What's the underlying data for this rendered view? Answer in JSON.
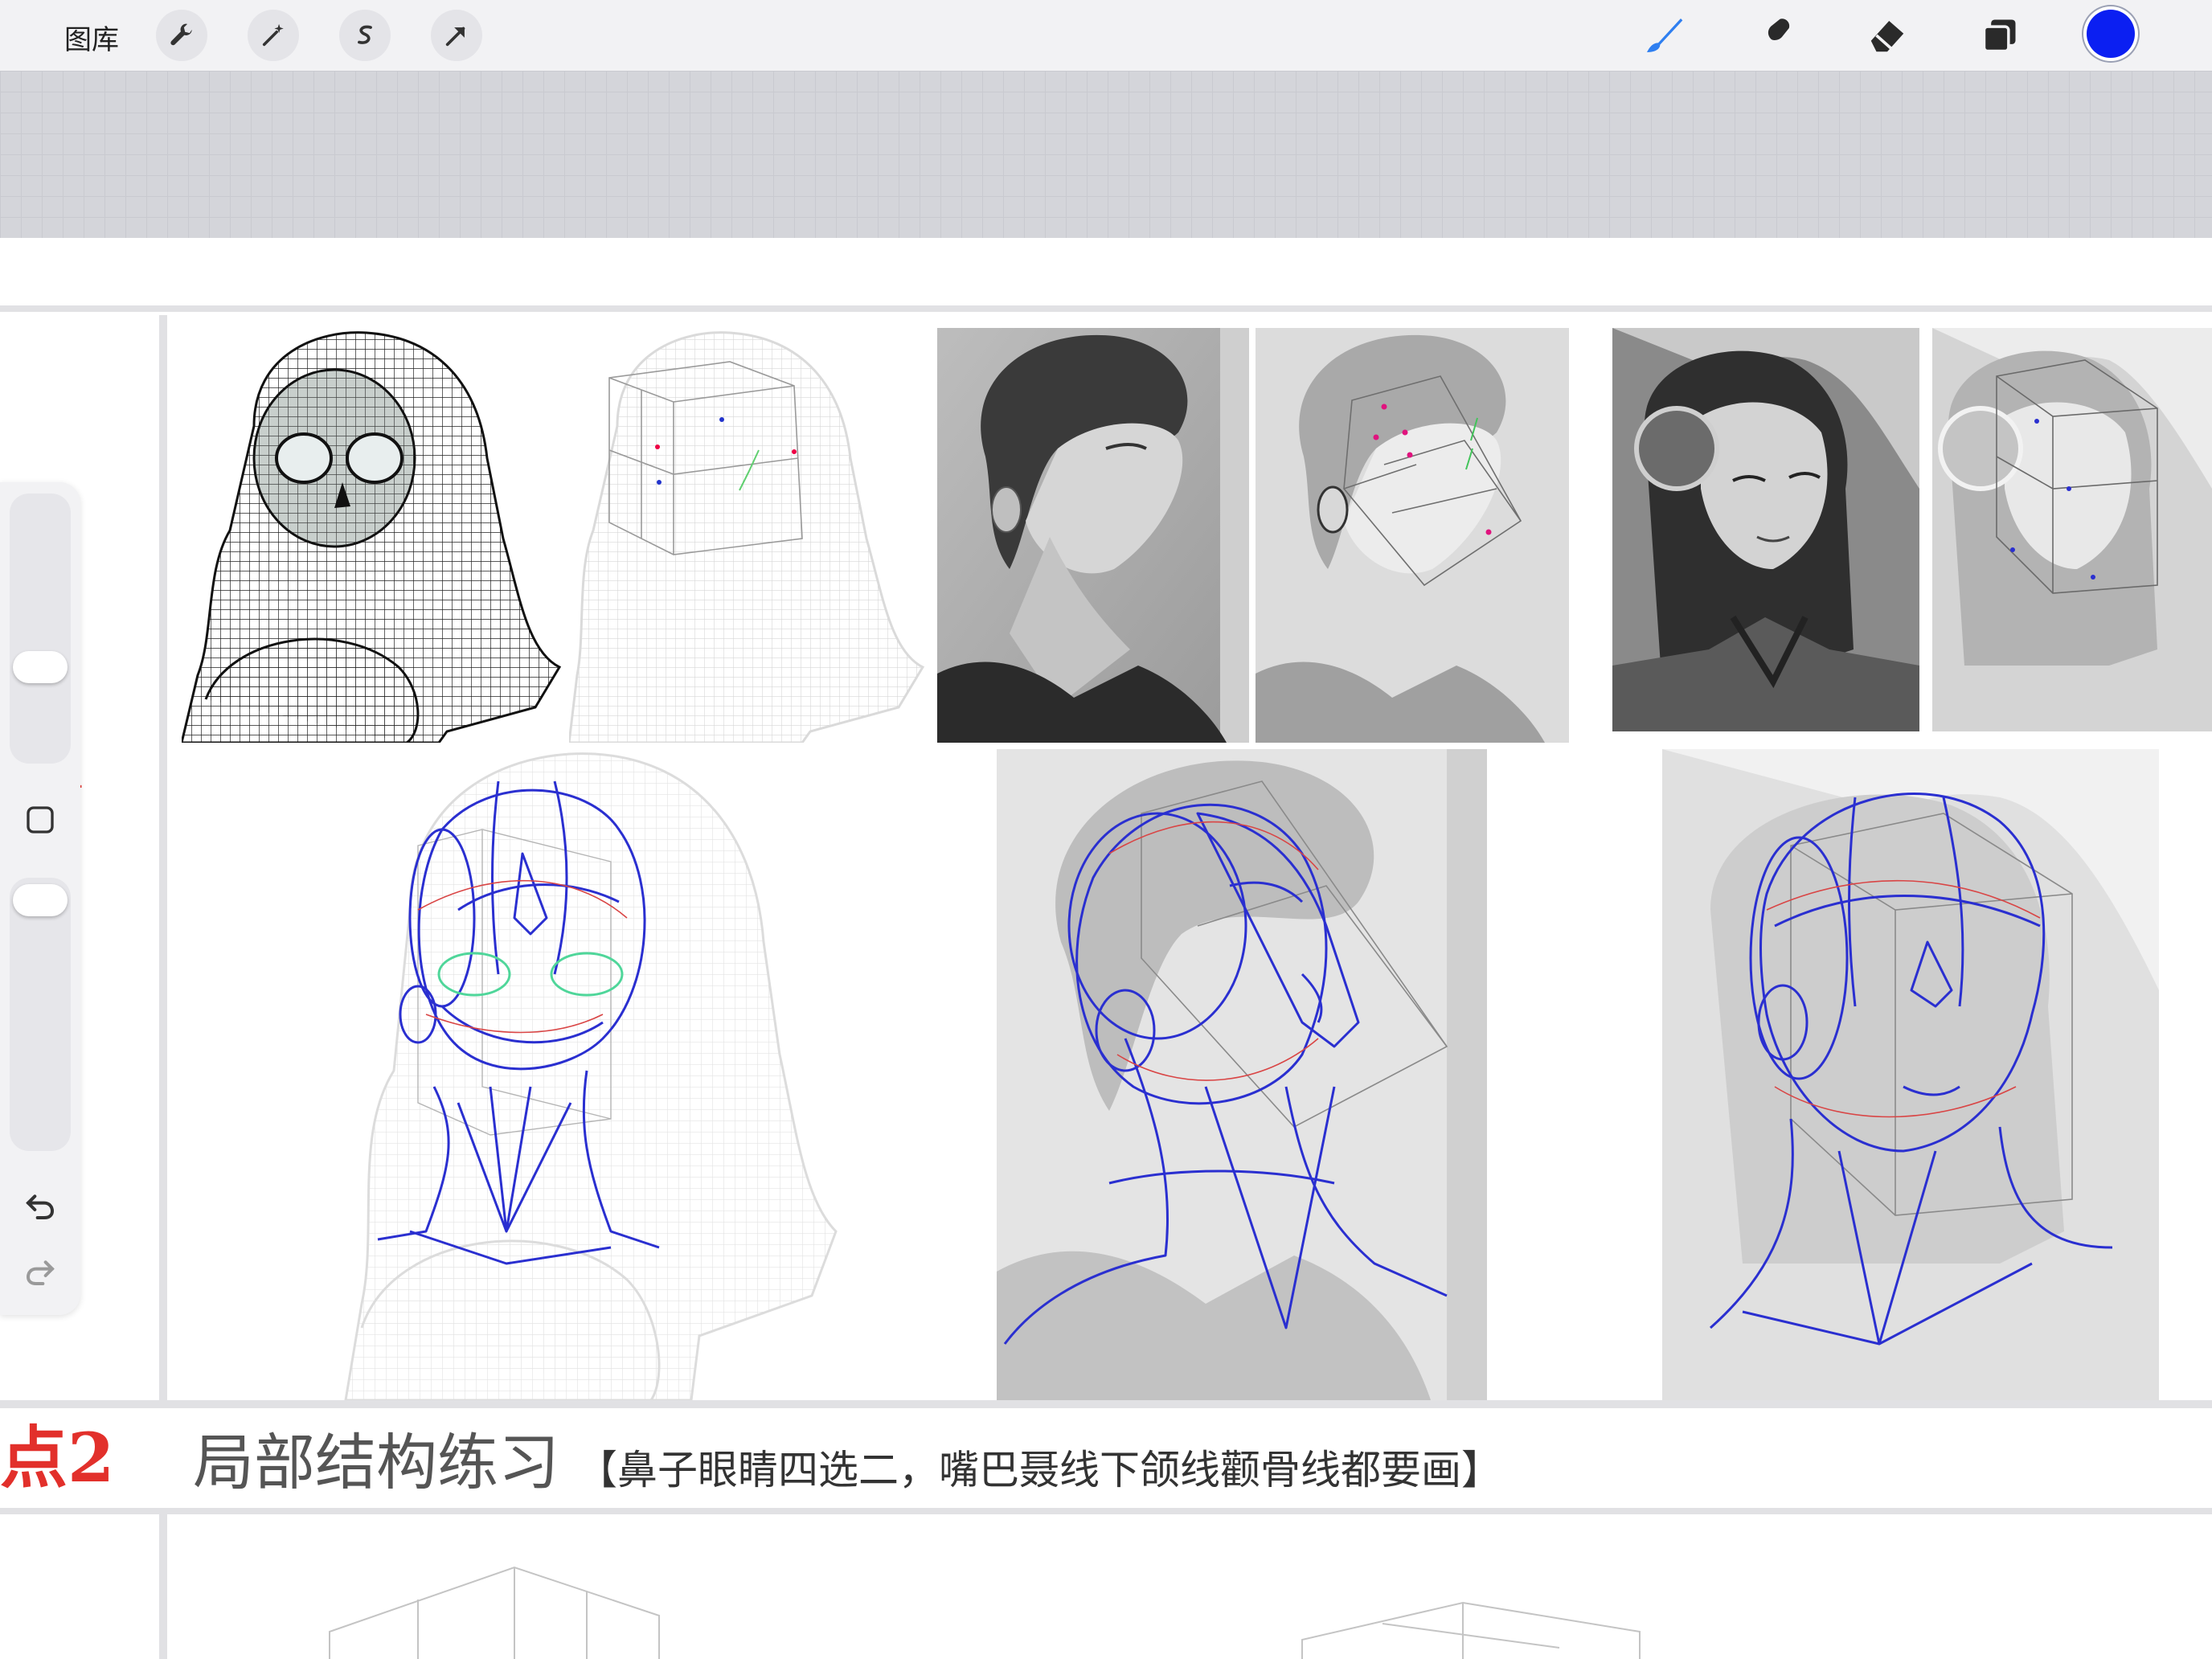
{
  "toolbar": {
    "gallery_label": "图库",
    "left_tools": [
      "wrench-icon",
      "magic-wand-icon",
      "selection-icon",
      "transform-arrow-icon"
    ],
    "right_tools": [
      "brush-icon",
      "smudge-icon",
      "eraser-icon",
      "layers-icon"
    ],
    "current_color": "#0b1ff2"
  },
  "sidebar": {
    "undo_icon": "undo-icon",
    "redo_icon": "redo-icon",
    "modify_icon": "square-icon"
  },
  "canvas": {
    "section_number": "点2",
    "section_title": "局部结构练习",
    "section_note": "【鼻子眼睛四选二，嘴巴聂线下颌线颧骨线都要画】",
    "left_edge_red_fragment": "l"
  },
  "colors": {
    "accent_red": "#e2302b",
    "construction_blue": "#2a2fd0",
    "construction_red": "#d94545",
    "eye_green": "#4fd69a"
  }
}
